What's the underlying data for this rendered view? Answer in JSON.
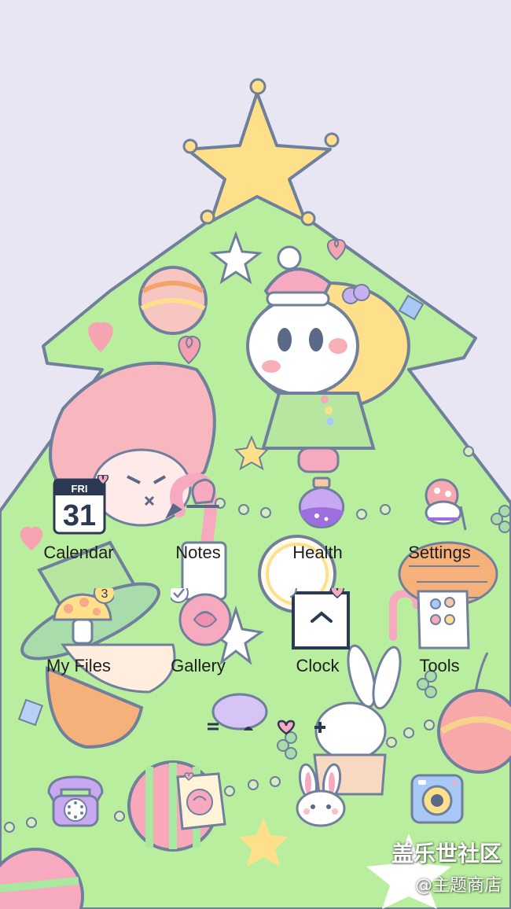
{
  "home_screen": {
    "row1": [
      {
        "label": "Calendar",
        "icon": "calendar-icon",
        "day": "FRI",
        "date": "31"
      },
      {
        "label": "Notes",
        "icon": "notes-icon"
      },
      {
        "label": "Health",
        "icon": "health-potion-icon"
      },
      {
        "label": "Settings",
        "icon": "settings-icon"
      }
    ],
    "row2": [
      {
        "label": "My Files",
        "icon": "mushroom-icon",
        "badge": "3"
      },
      {
        "label": "Gallery",
        "icon": "rose-icon"
      },
      {
        "label": "Clock",
        "icon": "clock-icon"
      },
      {
        "label": "Tools",
        "icon": "tools-icon"
      }
    ]
  },
  "dock": [
    {
      "icon": "phone-icon"
    },
    {
      "icon": "messages-icon"
    },
    {
      "icon": "bunny-icon"
    },
    {
      "icon": "camera-icon"
    }
  ],
  "watermark": {
    "line1": "盖乐世社区",
    "line2": "@主题商店"
  },
  "colors": {
    "background": "#e8e6f2",
    "tree": "#b8eea0",
    "outline": "#7c8aa6",
    "star": "#ffe08a"
  }
}
